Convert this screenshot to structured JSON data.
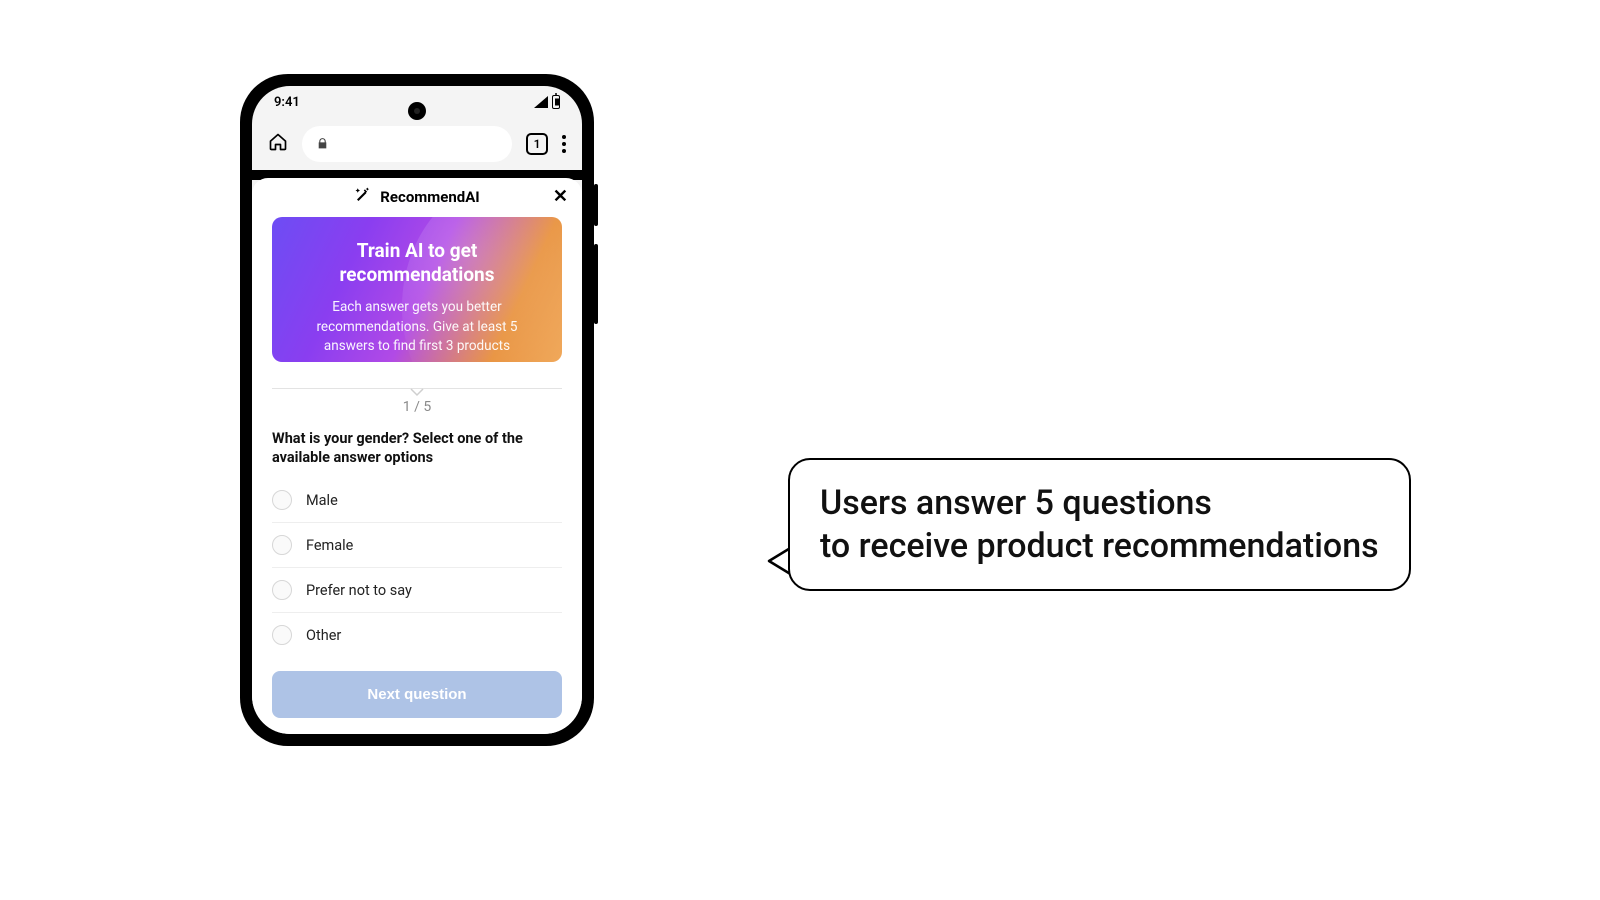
{
  "statusbar": {
    "time": "9:41"
  },
  "browser": {
    "tab_count": "1"
  },
  "app": {
    "title": "RecommendAI",
    "card": {
      "heading": "Train AI to get recommendations",
      "sub": "Each answer gets you better recommendations. Give at least 5 answers to find first 3 products"
    },
    "progress": "1 / 5",
    "question": "What is your gender? Select one of the available answer options",
    "options": [
      "Male",
      "Female",
      "Prefer not to say",
      "Other"
    ],
    "next_label": "Next question"
  },
  "callout": {
    "line1": "Users answer 5 questions",
    "line2": "to receive product recommendations"
  }
}
